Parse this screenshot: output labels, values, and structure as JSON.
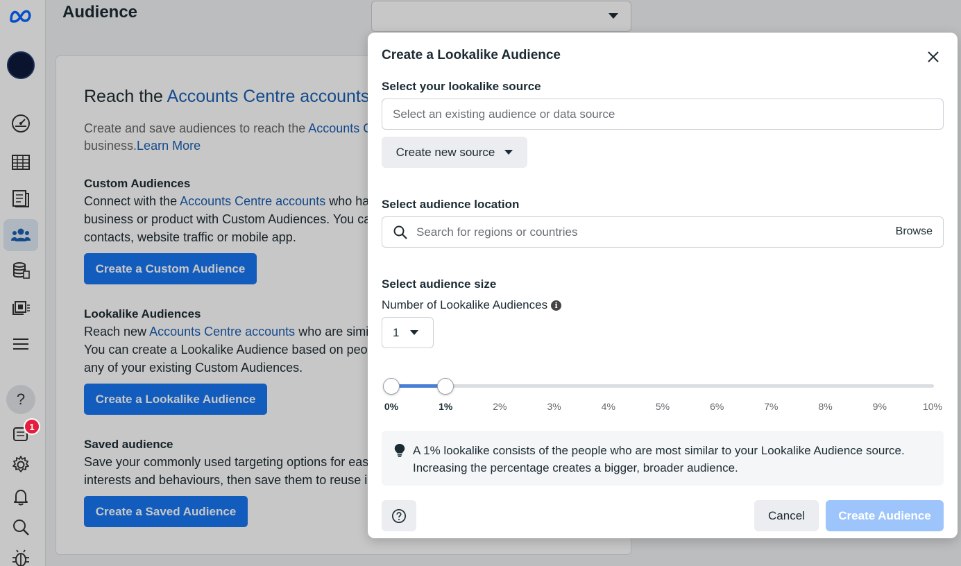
{
  "header": {
    "title": "Audience"
  },
  "sidebar": {
    "notification_count": "1",
    "help_glyph": "?"
  },
  "card": {
    "headline_prefix": "Reach the ",
    "headline_link": "Accounts Centre accounts",
    "desc_prefix": "Create and save audiences to reach the ",
    "desc_link": "Accounts Ce",
    "desc_suffix": "business.",
    "learn_more": "Learn More",
    "custom": {
      "title": "Custom Audiences",
      "line1_prefix": "Connect with the ",
      "line1_link": "Accounts Centre accounts",
      "line1_suffix": " who hav",
      "line2": "business or product with Custom Audiences. You can",
      "line3": "contacts, website traffic or mobile app.",
      "button": "Create a Custom Audience"
    },
    "lookalike": {
      "title": "Lookalike Audiences",
      "line1_prefix": "Reach new ",
      "line1_link": "Accounts Centre accounts",
      "line1_suffix": " who are simila",
      "line2": "You can create a Lookalike Audience based on people",
      "line3": "any of your existing Custom Audiences.",
      "button": "Create a Lookalike Audience"
    },
    "saved": {
      "title": "Saved audience",
      "line1": "Save your commonly used targeting options for easy",
      "line2": "interests and behaviours, then save them to reuse in f",
      "button": "Create a Saved Audience"
    }
  },
  "modal": {
    "title": "Create a Lookalike Audience",
    "source_label": "Select your lookalike source",
    "source_placeholder": "Select an existing audience or data source",
    "create_source": "Create new source",
    "location_label": "Select audience location",
    "location_placeholder": "Search for regions or countries",
    "browse": "Browse",
    "size_label": "Select audience size",
    "number_label": "Number of Lookalike Audiences",
    "number_value": "1",
    "slider": {
      "min_percent": 0,
      "max_percent": 10,
      "range_start": 0,
      "range_end": 1,
      "ticks": [
        "0%",
        "1%",
        "2%",
        "3%",
        "4%",
        "5%",
        "6%",
        "7%",
        "8%",
        "9%",
        "10%"
      ]
    },
    "tip_line1": "A 1% lookalike consists of the people who are most similar to your Lookalike Audience source.",
    "tip_line2": "Increasing the percentage creates a bigger, broader audience.",
    "cancel": "Cancel",
    "create": "Create Audience"
  },
  "colors": {
    "accent": "#1877f2",
    "link": "#1a5fb4",
    "slider_fill": "#4a7fd6",
    "disabled_button": "#9ec5fb"
  },
  "icons": [
    "meta-logo-icon",
    "dashboard-icon",
    "table-icon",
    "reports-icon",
    "audience-icon",
    "billing-icon",
    "catalog-icon",
    "menu-icon",
    "help-icon",
    "notifications-icon",
    "gear-icon",
    "bell-icon",
    "search-icon",
    "bug-icon",
    "close-icon",
    "lightbulb-icon",
    "info-icon"
  ]
}
